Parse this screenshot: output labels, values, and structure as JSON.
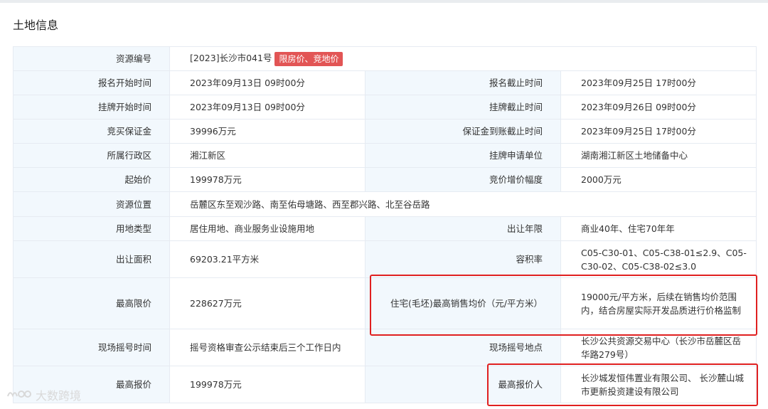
{
  "section_title": "土地信息",
  "resource": {
    "label": "资源编号",
    "value": "[2023]长沙市041号",
    "tag": "限房价、竞地价"
  },
  "rows": [
    {
      "l1": "报名开始时间",
      "v1": "2023年09月13日 09时00分",
      "l2": "报名截止时间",
      "v2": "2023年09月25日 17时00分"
    },
    {
      "l1": "挂牌开始时间",
      "v1": "2023年09月13日 09时00分",
      "l2": "挂牌截止时间",
      "v2": "2023年09月26日 09时00分"
    },
    {
      "l1": "竞买保证金",
      "v1": "39996万元",
      "l2": "保证金到账截止时间",
      "v2": "2023年09月25日 17时00分"
    },
    {
      "l1": "所属行政区",
      "v1": "湘江新区",
      "l2": "挂牌申请单位",
      "v2": "湖南湘江新区土地储备中心"
    },
    {
      "l1": "起始价",
      "v1": "199978万元",
      "l2": "竞价增价幅度",
      "v2": "2000万元"
    }
  ],
  "location": {
    "label": "资源位置",
    "value": "岳麓区东至观沙路、南至佑母塘路、西至郡兴路、北至谷岳路"
  },
  "rows2": [
    {
      "l1": "用地类型",
      "v1": "居住用地、商业服务业设施用地",
      "l2": "出让年限",
      "v2": "商业40年、住宅70年年"
    },
    {
      "l1": "出让面积",
      "v1": "69203.21平方米",
      "l2": "容积率",
      "v2": "C05-C30-01、C05-C38-01≤2.9、C05-C30-02、C05-C38-02≤3.0"
    }
  ],
  "limit_row": {
    "l1": "最高限价",
    "v1": "228627万元",
    "l2": "住宅(毛坯)最高销售均价（元/平方米）",
    "v2": "19000元/平方米，后续在销售均价范围内，结合房屋实际开发品质进行价格监制"
  },
  "lottery_row": {
    "l1": "现场摇号时间",
    "v1": "摇号资格审查公示结束后三个工作日内",
    "l2": "现场摇号地点",
    "v2": "长沙公共资源交易中心（长沙市岳麓区岳华路279号）"
  },
  "bid_row": {
    "l1": "最高报价",
    "v1": "199978万元",
    "l2": "最高报价人",
    "v2": "长沙城发恒伟置业有限公司、 长沙麓山城市更新投资建设有限公司"
  },
  "watermark": "大数跨境",
  "colors": {
    "label_bg": "#f2f8fd",
    "highlight": "#e02020",
    "tag_bg": "#e25555"
  }
}
